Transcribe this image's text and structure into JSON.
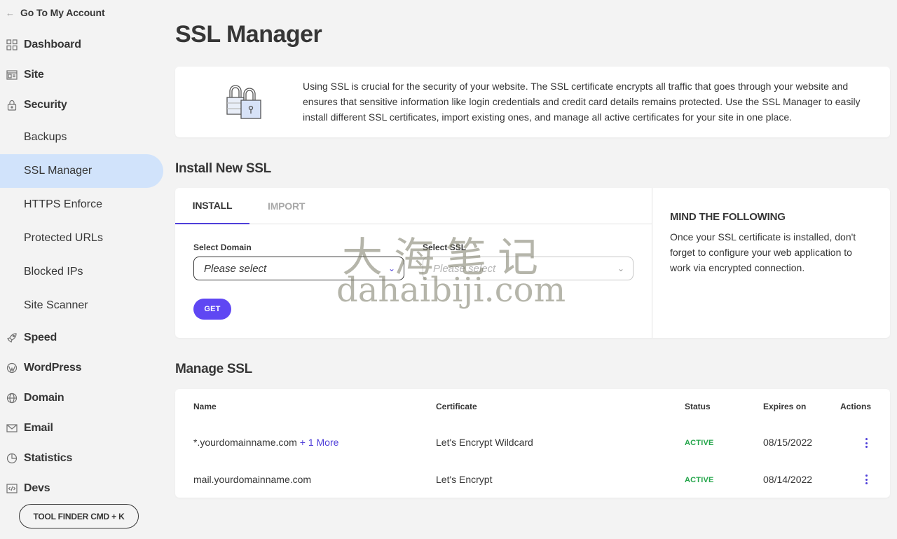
{
  "sidebar": {
    "back_label": "Go To My Account",
    "main_items": [
      {
        "label": "Dashboard",
        "icon": "grid-icon"
      },
      {
        "label": "Site",
        "icon": "site-icon"
      },
      {
        "label": "Security",
        "icon": "lock-icon"
      }
    ],
    "security_sub": [
      {
        "label": "Backups"
      },
      {
        "label": "SSL Manager",
        "active": true
      },
      {
        "label": "HTTPS Enforce"
      },
      {
        "label": "Protected URLs"
      },
      {
        "label": "Blocked IPs"
      },
      {
        "label": "Site Scanner"
      }
    ],
    "lower_items": [
      {
        "label": "Speed",
        "icon": "rocket-icon"
      },
      {
        "label": "WordPress",
        "icon": "wordpress-icon"
      },
      {
        "label": "Domain",
        "icon": "globe-icon"
      },
      {
        "label": "Email",
        "icon": "mail-icon"
      },
      {
        "label": "Statistics",
        "icon": "pie-chart-icon"
      },
      {
        "label": "Devs",
        "icon": "code-icon"
      }
    ],
    "tool_finder_label": "TOOL FINDER CMD + K"
  },
  "page": {
    "title": "SSL Manager",
    "intro": "Using SSL is crucial for the security of your website. The SSL certificate encrypts all traffic that goes through your website and ensures that sensitive information like login credentials and credit card details remains protected. Use the SSL Manager to easily install different SSL certificates, import existing ones, and manage all active certificates for your site in one place."
  },
  "install": {
    "section_title": "Install New SSL",
    "tabs": [
      "INSTALL",
      "IMPORT"
    ],
    "domain_label": "Select Domain",
    "domain_placeholder": "Please select",
    "ssl_label": "Select SSL",
    "ssl_placeholder": "Please select",
    "get_label": "GET",
    "mind_title": "MIND THE FOLLOWING",
    "mind_text": "Once your SSL certificate is installed, don't forget to configure your web application to work via encrypted connection."
  },
  "manage": {
    "section_title": "Manage SSL",
    "columns": [
      "Name",
      "Certificate",
      "Status",
      "Expires on",
      "Actions"
    ],
    "rows": [
      {
        "name": "*.yourdomainname.com",
        "more": "+ 1 More",
        "certificate": "Let's Encrypt Wildcard",
        "status": "ACTIVE",
        "expires": "08/15/2022"
      },
      {
        "name": "mail.yourdomainname.com",
        "more": "",
        "certificate": "Let's Encrypt",
        "status": "ACTIVE",
        "expires": "08/14/2022"
      }
    ]
  },
  "watermark": {
    "cn": "大海笔记",
    "en": "dahaibiji.com"
  },
  "colors": {
    "accent": "#5f47f3",
    "active_nav": "#d1e3fb",
    "status_active": "#23a54a"
  }
}
